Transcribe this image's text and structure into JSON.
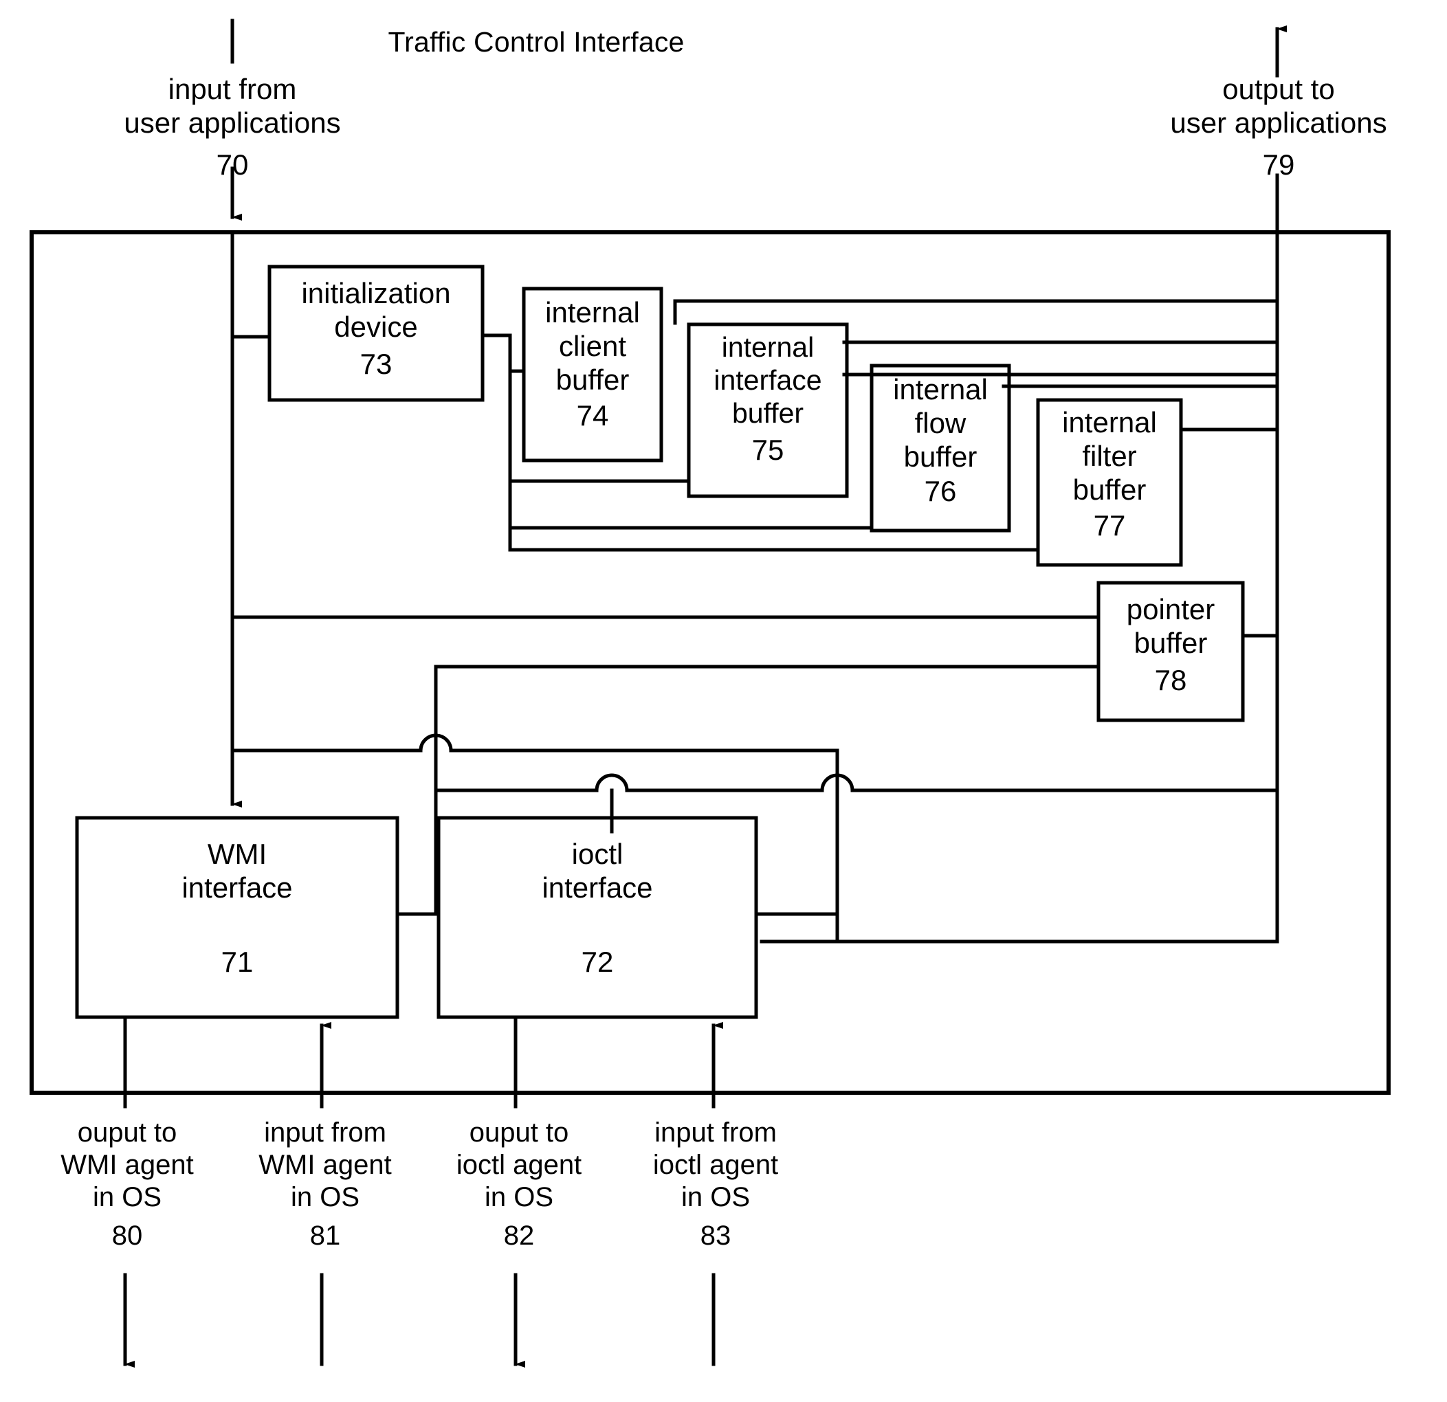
{
  "figure": {
    "title": "Traffic Control Interface"
  },
  "external_ports": {
    "top_left": {
      "label": "input from\nuser applications",
      "ref": "70",
      "direction": "input",
      "arrow": "down"
    },
    "top_right": {
      "label": "output to\nuser applications",
      "ref": "79",
      "direction": "output",
      "arrow": "up"
    },
    "bottom": [
      {
        "label": "ouput to\nWMI agent\nin OS",
        "ref": "80",
        "direction": "output",
        "arrow": "down"
      },
      {
        "label": "input from\nWMI agent\nin OS",
        "ref": "81",
        "direction": "input",
        "arrow": "up"
      },
      {
        "label": "ouput to\nioctl agent\nin OS",
        "ref": "82",
        "direction": "output",
        "arrow": "down"
      },
      {
        "label": "input from\nioctl agent\nin OS",
        "ref": "83",
        "direction": "input",
        "arrow": "up"
      }
    ]
  },
  "blocks": [
    {
      "id": "initialization-device",
      "label": "initialization\ndevice",
      "ref": "73"
    },
    {
      "id": "internal-client-buffer",
      "label": "internal\nclient\nbuffer",
      "ref": "74"
    },
    {
      "id": "internal-interface-buffer",
      "label": "internal\ninterface\nbuffer",
      "ref": "75"
    },
    {
      "id": "internal-flow-buffer",
      "label": "internal\nflow\nbuffer",
      "ref": "76"
    },
    {
      "id": "internal-filter-buffer",
      "label": "internal\nfilter\nbuffer",
      "ref": "77"
    },
    {
      "id": "pointer-buffer",
      "label": "pointer\nbuffer",
      "ref": "78"
    },
    {
      "id": "wmi-interface",
      "label": "WMI\ninterface",
      "ref": "71"
    },
    {
      "id": "ioctl-interface",
      "label": "ioctl\ninterface",
      "ref": "72"
    }
  ],
  "style": {
    "stroke": "#000000",
    "background": "#ffffff"
  }
}
